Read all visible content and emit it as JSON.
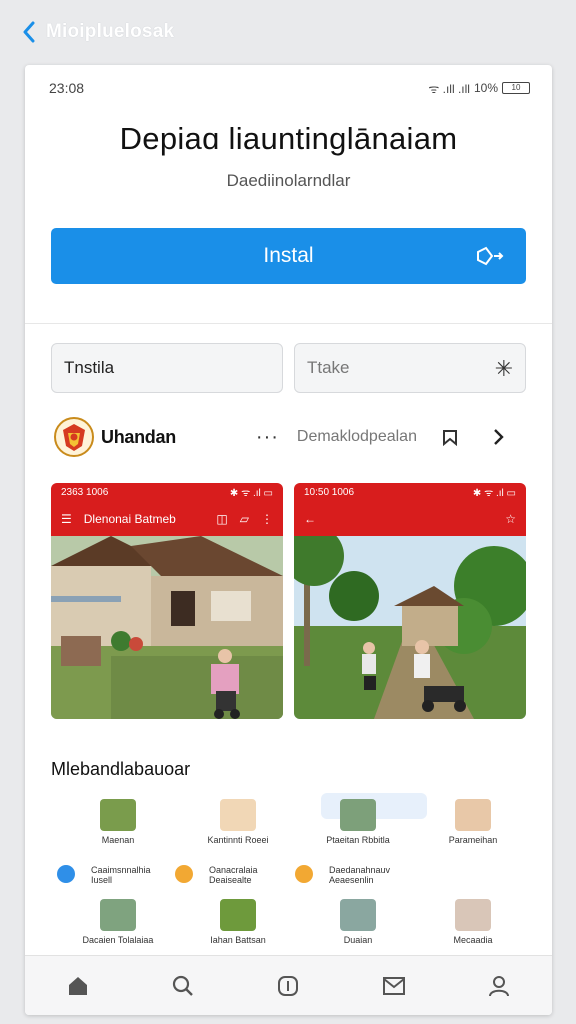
{
  "nav": {
    "back_icon": "chevron-left-icon",
    "title": "Mioipluelosak"
  },
  "status": {
    "time": "23:08",
    "signal": "ᯤ .ıll .ıll",
    "battery_pct": "10%",
    "battery_label": "10"
  },
  "app": {
    "title": "Depiaɑ liauntinglānaiam",
    "subtitle": "Daediinolarndlar",
    "install_label": "Instal"
  },
  "fields": {
    "left_value": "Tnstila",
    "right_value": "Ttake",
    "right_icon": "asterisk-icon"
  },
  "developer": {
    "name": "Uhandan",
    "dots": "···",
    "link": "Demaklodpealan"
  },
  "screens": [
    {
      "time": "2363 1006",
      "status_icons": "✱ ᯤ .ıl ▭",
      "title": "Dlenonai Batmeb"
    },
    {
      "time": "10:50 1006",
      "status_icons": "✱ ᯤ .ıl ▭"
    }
  ],
  "section": {
    "title": "Mlebandlabauoar"
  },
  "grid_items": [
    {
      "label": "Maenan"
    },
    {
      "label": "Kantinnti Roeei"
    },
    {
      "label": "Ptaeitan Rbbitla"
    },
    {
      "label": "Parameihan"
    },
    {
      "label": "Caaimsnnalhia Iusell"
    },
    {
      "label": "Oanacralaia Deaisealte"
    },
    {
      "label": "Daedanahnauv Aeaesenlin"
    },
    {
      "label": ""
    },
    {
      "label": "Dacaien Tolalaiaa"
    },
    {
      "label": "Iahan Battsan"
    },
    {
      "label": "Duaian"
    },
    {
      "label": "Mecaadia"
    }
  ],
  "tabs": [
    "home-icon",
    "search-icon",
    "updates-icon",
    "mail-icon",
    "profile-icon"
  ],
  "colors": {
    "accent": "#1a8fe8",
    "app_red": "#d81d1d"
  }
}
